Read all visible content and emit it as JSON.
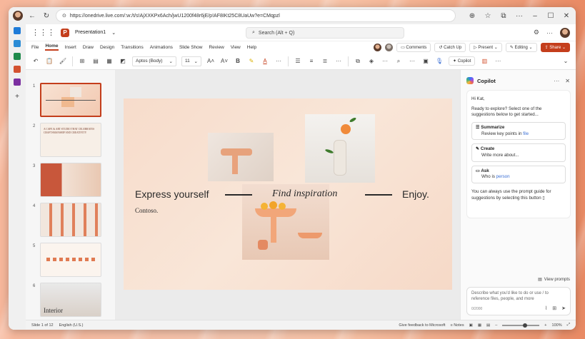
{
  "browser": {
    "url": "https://onedrive.live.com/:w:/t/s!AjXXKPx6Ach/jwU1200f48r6jE/p!AF8IKt25C8UaUw?e=CMqpzl"
  },
  "office": {
    "doc_title": "Presentation1",
    "search_placeholder": "Search (Alt + Q)"
  },
  "menu": {
    "tabs": [
      "File",
      "Home",
      "Insert",
      "Draw",
      "Design",
      "Transitions",
      "Animations",
      "Slide Show",
      "Review",
      "View",
      "Help"
    ],
    "active_tab": "Home",
    "comments_label": "Comments",
    "catchup_label": "Catch Up",
    "present_label": "Present",
    "editing_label": "Editing",
    "share_label": "Share"
  },
  "ribbon": {
    "font_name": "Aptos (Body)",
    "font_size": "11",
    "copilot_label": "Copilot"
  },
  "thumbnails": {
    "numbers": [
      "1",
      "2",
      "3",
      "4",
      "5",
      "6"
    ],
    "t2_text": "A CAFE & ART STUDIO THAT CELEBRATES CRAFTSMANSHIP AND CREATIVITY",
    "t6_text": "Interior"
  },
  "slide": {
    "express": "Express yourself",
    "find": "Find inspiration",
    "enjoy": "Enjoy.",
    "contoso": "Contoso."
  },
  "copilot": {
    "title": "Copilot",
    "greeting": "Hi Kat,",
    "intro": "Ready to explore? Select one of the suggestions below to get started...",
    "suggestions": [
      {
        "title": "Summarize",
        "sub": "Review key points in ",
        "link": "file"
      },
      {
        "title": "Create",
        "sub": "Write more about...",
        "link": ""
      },
      {
        "title": "Ask",
        "sub": "Who is ",
        "link": "person"
      }
    ],
    "guide_text": "You can always use the prompt guide for suggestions by selecting this button",
    "view_prompts": "View prompts",
    "input_placeholder": "Describe what you'd like to do or use / to reference files, people, and more",
    "char_count": "0/2000"
  },
  "status": {
    "slide_of": "Slide 1 of 12",
    "language": "English (U.S.)",
    "feedback": "Give feedback to Microsoft",
    "notes": "Notes",
    "zoom": "100%",
    "zoom_fraction": 0.55
  },
  "colors": {
    "accent": "#c43e1c",
    "link": "#3b6fd4"
  }
}
